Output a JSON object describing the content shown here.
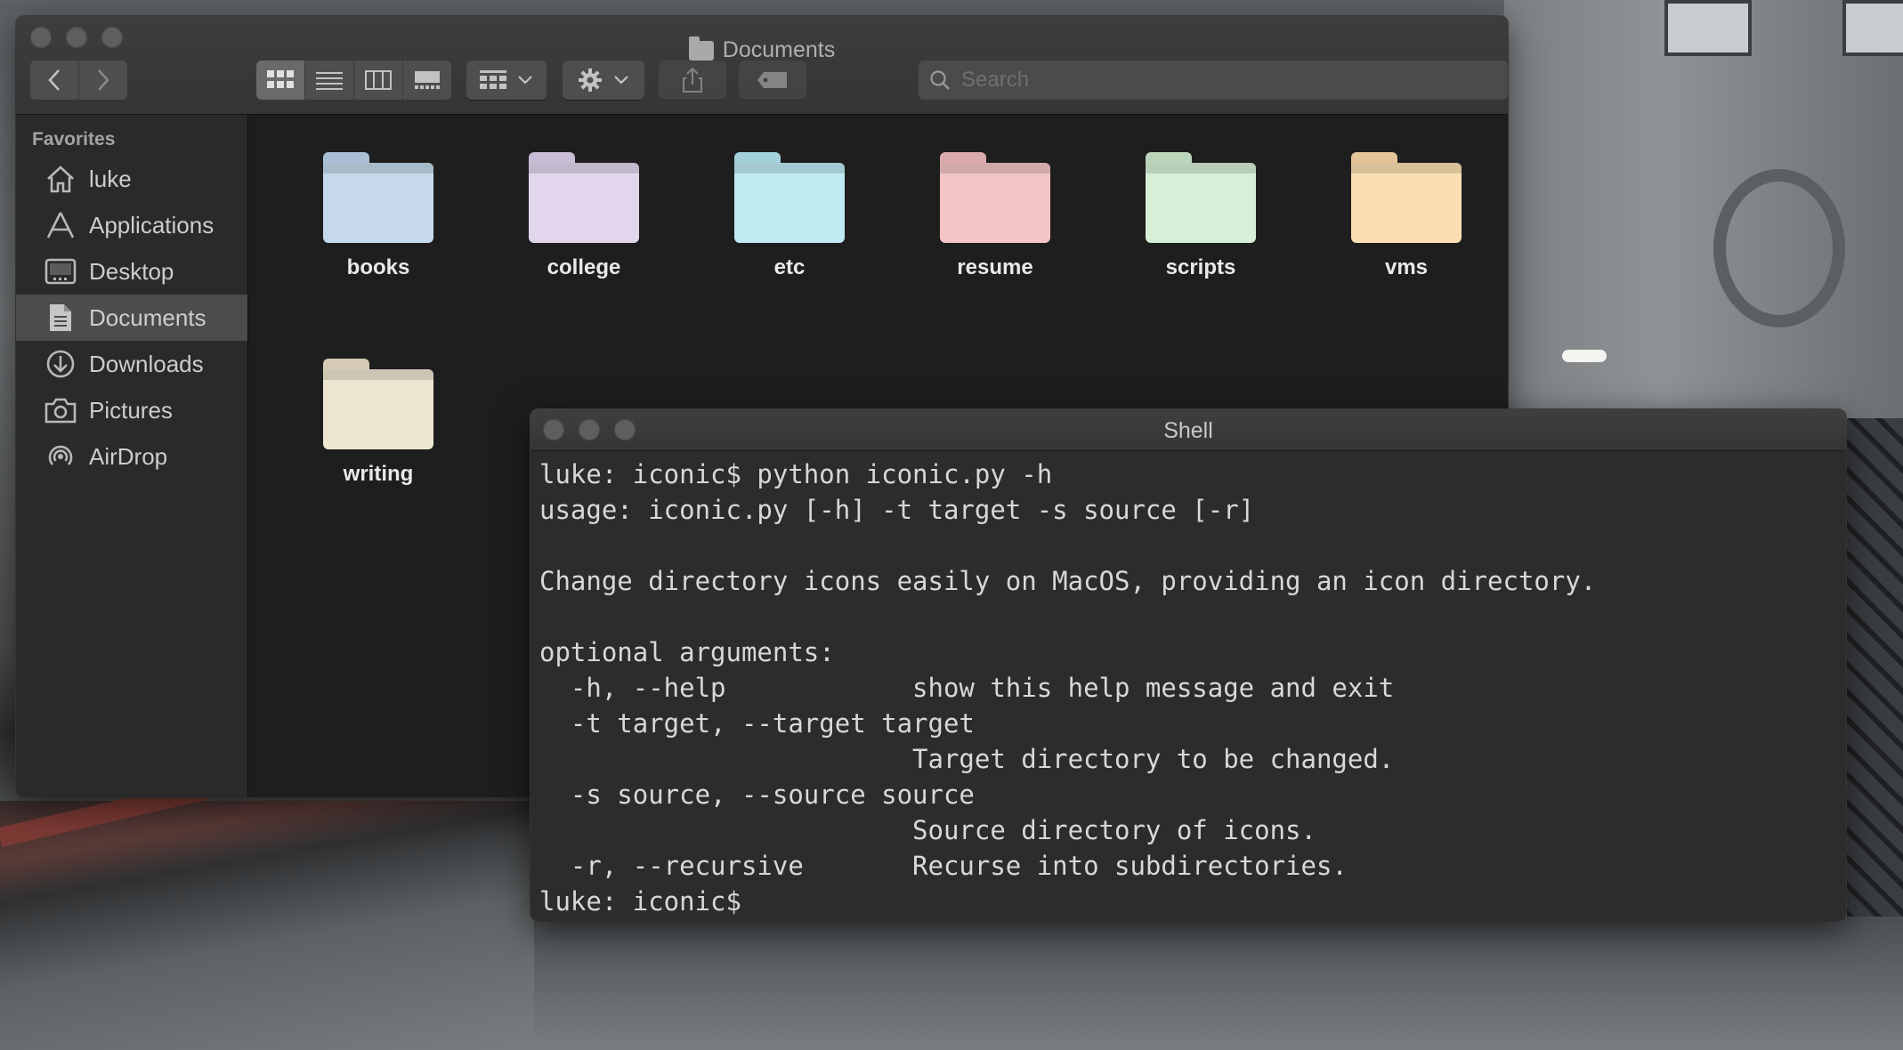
{
  "finder": {
    "title": "Documents",
    "search_placeholder": "Search",
    "sidebar": {
      "heading": "Favorites",
      "items": [
        {
          "label": "luke",
          "icon": "home-icon"
        },
        {
          "label": "Applications",
          "icon": "applications-icon"
        },
        {
          "label": "Desktop",
          "icon": "desktop-icon"
        },
        {
          "label": "Documents",
          "icon": "documents-icon",
          "active": true
        },
        {
          "label": "Downloads",
          "icon": "downloads-icon"
        },
        {
          "label": "Pictures",
          "icon": "pictures-icon"
        },
        {
          "label": "AirDrop",
          "icon": "airdrop-icon"
        }
      ]
    },
    "folders": [
      {
        "label": "books",
        "color": "#c5d9ea"
      },
      {
        "label": "college",
        "color": "#e1d6ec"
      },
      {
        "label": "etc",
        "color": "#bfeaf2"
      },
      {
        "label": "resume",
        "color": "#f3c5c4"
      },
      {
        "label": "scripts",
        "color": "#d6efd6"
      },
      {
        "label": "vms",
        "color": "#fbdfb2"
      },
      {
        "label": "writing",
        "color": "#efe6d2"
      }
    ]
  },
  "shell": {
    "title": "Shell",
    "lines": [
      "luke: iconic$ python iconic.py -h",
      "usage: iconic.py [-h] -t target -s source [-r]",
      "",
      "Change directory icons easily on MacOS, providing an icon directory.",
      "",
      "optional arguments:",
      "  -h, --help            show this help message and exit",
      "  -t target, --target target",
      "                        Target directory to be changed.",
      "  -s source, --source source",
      "                        Source directory of icons.",
      "  -r, --recursive       Recurse into subdirectories.",
      "luke: iconic$"
    ]
  }
}
